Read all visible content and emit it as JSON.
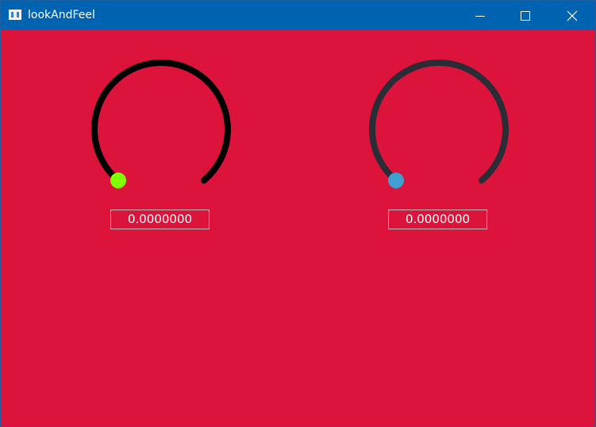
{
  "window": {
    "title": "lookAndFeel",
    "icon": "app-window-icon",
    "controls": [
      "minimize-icon",
      "maximize-icon",
      "close-icon"
    ],
    "titlebar_color": "#0063b1",
    "background_color": "#dc143c"
  },
  "dials": [
    {
      "value_text": "0.0000000",
      "value_fraction": 0.0,
      "track_color": "#000000",
      "thumb_color": "#7fff00"
    },
    {
      "value_text": "0.0000000",
      "value_fraction": 0.0,
      "track_color": "#2a2d36",
      "thumb_color": "#3f9fd0"
    }
  ]
}
